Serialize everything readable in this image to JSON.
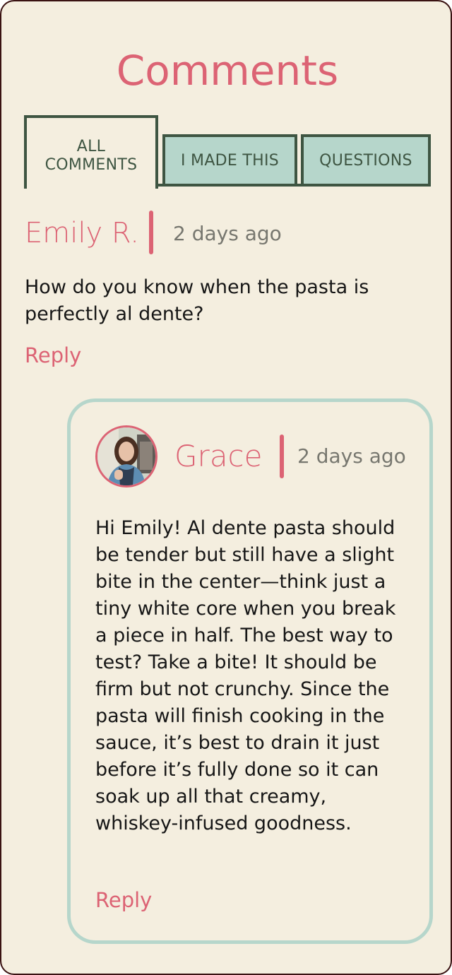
{
  "header": {
    "title": "Comments"
  },
  "tabs": [
    {
      "label_line1": "ALL",
      "label_line2": "COMMENTS",
      "active": true
    },
    {
      "label": "I MADE THIS",
      "active": false
    },
    {
      "label": "QUESTIONS",
      "active": false
    }
  ],
  "comment": {
    "author": "Emily R.",
    "time": "2 days ago",
    "body": "How do you know when the pasta is perfectly al dente?",
    "reply_label": "Reply"
  },
  "reply": {
    "author": "Grace",
    "time": "2 days ago",
    "avatar_icon": "user-photo-avatar",
    "body": "Hi Emily! Al dente pasta should be tender but still have a slight bite in the center—think just a tiny white core when you break a piece in half. The best way to test? Take a bite! It should be firm but not crunchy. Since the pasta will finish cooking in the sauce, it’s best to drain it just before it’s fully done so it can soak up all that creamy, whiskey-infused goodness.",
    "reply_label": "Reply"
  },
  "colors": {
    "accent": "#dc6374",
    "tab_border": "#3e5542",
    "tab_fill": "#b6d6cb",
    "background": "#f4eedf",
    "reply_border": "#b6d6cb"
  }
}
